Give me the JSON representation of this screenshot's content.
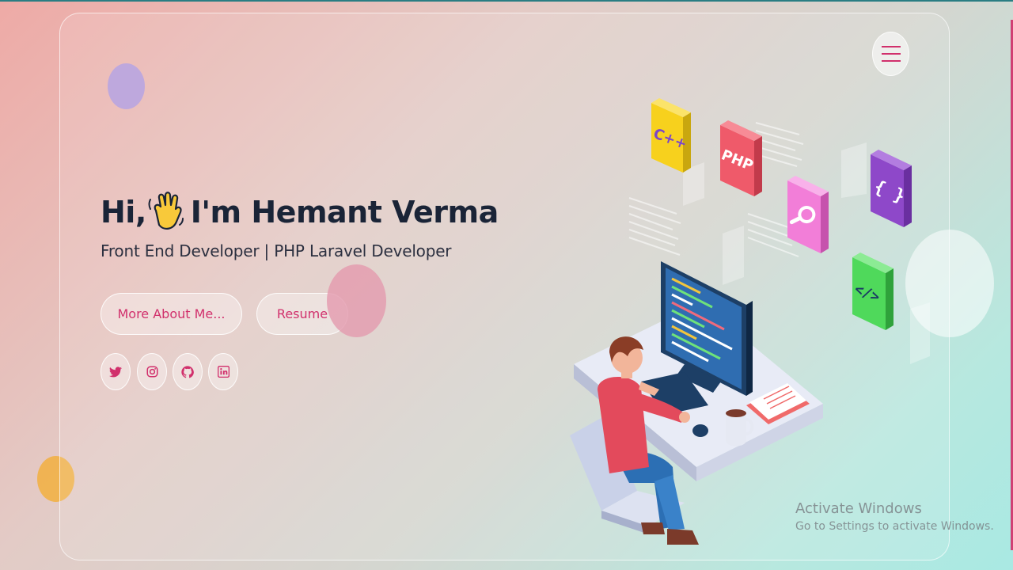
{
  "hero": {
    "greeting": "Hi,",
    "name": "I'm Hemant Verma",
    "subtitle": "Front End Developer | PHP Laravel Developer"
  },
  "buttons": {
    "about": "More About Me...",
    "resume": "Resume"
  },
  "social": [
    {
      "icon": "twitter-icon"
    },
    {
      "icon": "instagram-icon"
    },
    {
      "icon": "github-icon"
    },
    {
      "icon": "linkedin-icon"
    }
  ],
  "illustration": {
    "tiles": [
      "C++",
      "PHP",
      "{ }",
      "</>"
    ]
  },
  "watermark": {
    "line1": "Activate Windows",
    "line2": "Go to Settings to activate Windows."
  },
  "colors": {
    "accent": "#d1306c",
    "title": "#1a2437",
    "menu_icon": "#d1306c"
  }
}
